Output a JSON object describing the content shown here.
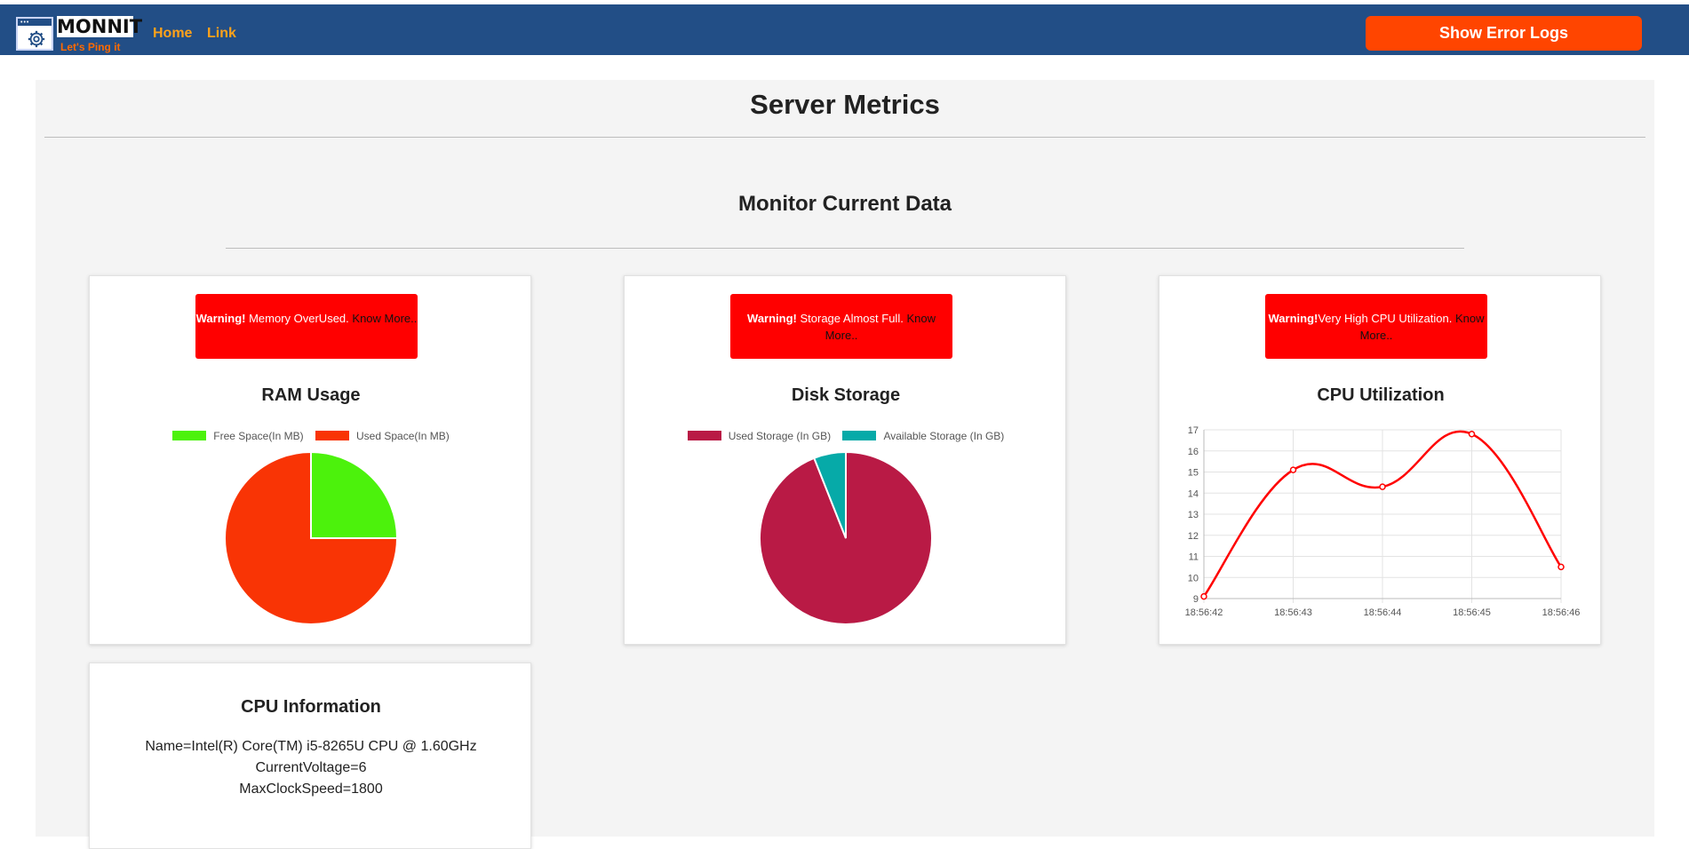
{
  "navbar": {
    "logo_word": "MONNIT",
    "logo_tagline": "Let's Ping it",
    "links": [
      "Home",
      "Link"
    ],
    "error_button": "Show Error Logs"
  },
  "page": {
    "title": "Server Metrics",
    "section_title": "Monitor Current Data"
  },
  "cards": {
    "ram": {
      "warning_bold": "Warning!",
      "warning_text": " Memory OverUsed.",
      "warning_link": " Know More..",
      "title": "RAM Usage"
    },
    "disk": {
      "warning_bold": "Warning!",
      "warning_text": " Storage Almost Full.",
      "warning_link": " Know More..",
      "title": "Disk Storage"
    },
    "cpu": {
      "warning_bold": "Warning!",
      "warning_text": "Very High CPU Utilization.",
      "warning_link": " Know More..",
      "title": "CPU Utilization"
    },
    "cpu_info": {
      "title": "CPU Information",
      "name": "Name=Intel(R) Core(TM) i5-8265U CPU @ 1.60GHz",
      "voltage": "CurrentVoltage=6",
      "clock": "MaxClockSpeed=1800"
    }
  },
  "colors": {
    "navbar": "#224e86",
    "error_button": "#ff4500",
    "warning": "#ff0000",
    "ram_free": "#4cf20c",
    "ram_used": "#f93405",
    "disk_used": "#b91a45",
    "disk_available": "#06aaa8",
    "cpu_line": "#ff0000"
  },
  "chart_data": [
    {
      "type": "pie",
      "title": "RAM Usage",
      "labels": [
        "Free Space(In MB)",
        "Used Space(In MB)"
      ],
      "values": [
        25,
        75
      ],
      "colors": [
        "#4cf20c",
        "#f93405"
      ],
      "legend": "top"
    },
    {
      "type": "pie",
      "title": "Disk Storage",
      "labels": [
        "Used Storage (In GB)",
        "Available Storage (In GB)"
      ],
      "values": [
        94,
        6
      ],
      "colors": [
        "#b91a45",
        "#06aaa8"
      ],
      "legend": "top"
    },
    {
      "type": "line",
      "title": "CPU Utilization",
      "categories": [
        "18:56:42",
        "18:56:43",
        "18:56:44",
        "18:56:45",
        "18:56:46"
      ],
      "values": [
        9.1,
        15.1,
        14.3,
        16.8,
        10.5
      ],
      "ylim": [
        9,
        17
      ],
      "yticks": [
        9,
        10,
        11,
        12,
        13,
        14,
        15,
        16,
        17
      ],
      "grid": true,
      "color": "#ff0000"
    }
  ]
}
